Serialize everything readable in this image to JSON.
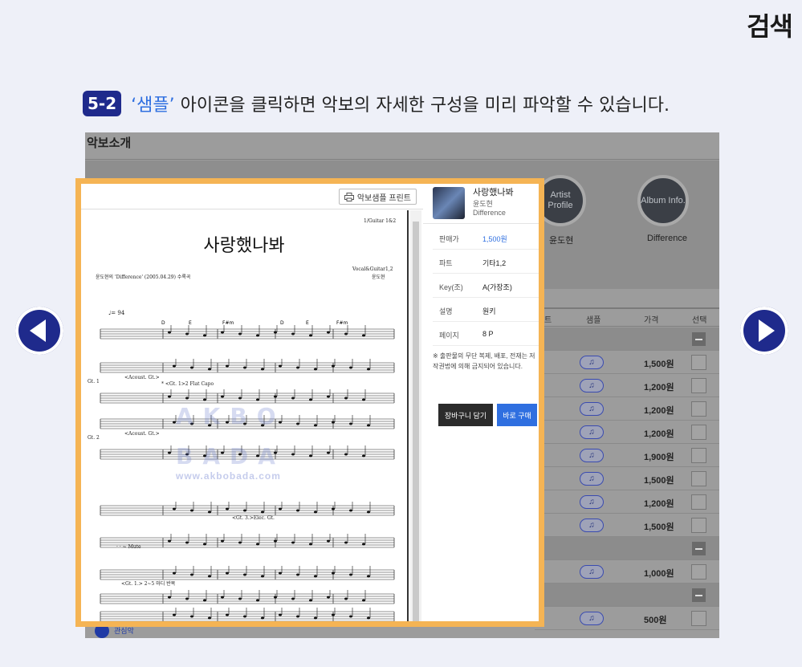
{
  "corner_title": "검색",
  "step": {
    "badge": "5-2",
    "highlight": "‘샘플’",
    "text": "아이콘을 클릭하면 악보의 자세한 구성을 미리 파악할 수 있습니다."
  },
  "background": {
    "page_heading": "악보소개",
    "song_title_partial": "사랑했나봐",
    "artist_profile_label": "Artist Profile",
    "album_info_label": "Album Info.",
    "artist_name": "윤도현",
    "album_name": "Difference",
    "table_headers": {
      "part": "트",
      "sample": "샘플",
      "price": "가격",
      "select": "선택"
    },
    "rows": [
      {
        "type": "section"
      },
      {
        "type": "item",
        "chip": "♫",
        "price": "1,500원"
      },
      {
        "type": "item",
        "chip": "♫",
        "price": "1,200원"
      },
      {
        "type": "item",
        "chip": "♫",
        "price": "1,200원"
      },
      {
        "type": "item",
        "chip": "♫",
        "price": "1,200원"
      },
      {
        "type": "item",
        "chip": "♫",
        "price": "1,900원"
      },
      {
        "type": "item",
        "chip": "♫",
        "price": "1,500원"
      },
      {
        "type": "item",
        "chip": "♫",
        "price": "1,200원"
      },
      {
        "type": "item",
        "chip": "♫",
        "price": "1,500원"
      },
      {
        "type": "section"
      },
      {
        "type": "item",
        "chip": "♫",
        "price": "1,000원"
      },
      {
        "type": "section"
      },
      {
        "type": "item",
        "chip": "♫",
        "price": "500원"
      }
    ],
    "footer_label": "관심악"
  },
  "modal": {
    "print_button": "악보샘플 프린트",
    "sheet": {
      "title": "사랑했나봐",
      "subtitle_left": "윤도현의 'Difference' (2005.04.29) 수록곡",
      "top_right": "1/Guitar 1&2",
      "right_credit_1": "Vocal&Guitar1,2",
      "right_credit_2": "윤도현",
      "tempo": "♩= 94",
      "chords": [
        "D",
        "E",
        "F#m",
        "D",
        "E",
        "F#m"
      ],
      "watermark_1": "AKBO",
      "watermark_2": "BADA",
      "watermark_3": "www.akbobada.com",
      "gt1": "Gt. 1",
      "gt2": "Gt. 2",
      "acoust": "<Acoust. Gt.>",
      "capo": "* <Gt. 1>2 Flat Capo",
      "elec": "<Gt. 3.>Elec. Gt.",
      "mute": "· · ~ Mute",
      "gt1_repeat": "<Gt. 1.> 2~5 마디 반복"
    },
    "info": {
      "title": "사랑했나봐",
      "artist": "윤도현",
      "album": "Difference",
      "rows": [
        {
          "k": "판매가",
          "v": "1,500원",
          "blue": true
        },
        {
          "k": "파트",
          "v": "기타1,2",
          "blue": false
        },
        {
          "k": "Key(조)",
          "v": "A(가장조)",
          "blue": false
        },
        {
          "k": "설명",
          "v": "원키",
          "blue": false
        },
        {
          "k": "페이지",
          "v": "8 P",
          "blue": false
        }
      ],
      "note": "※ 출판물의 무단 복제, 배포, 전재는 저작권법에 의해 금지되어 있습니다.",
      "cart_button": "장바구니 담기",
      "buy_button": "바로 구매"
    }
  },
  "colors": {
    "accent": "#1f2a8c",
    "highlight": "#2f6fe0",
    "modal_border": "#f5b454"
  }
}
